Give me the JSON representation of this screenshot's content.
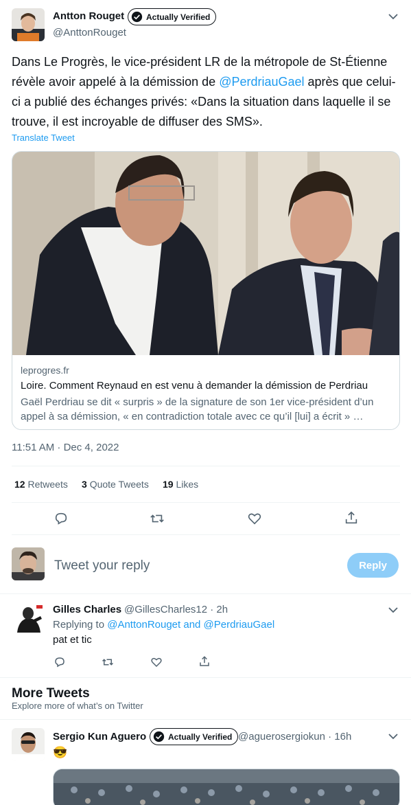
{
  "main_tweet": {
    "author_name": "Antton Rouget",
    "verified_badge": "Actually Verified",
    "author_handle": "@AnttonRouget",
    "text_before": "Dans Le Progrès, le vice-président LR de la métropole de St-Étienne révèle avoir appelé à la démission de ",
    "mention": "@PerdriauGael",
    "text_after": " après que celui-ci a publié des échanges privés: «Dans la situation dans laquelle il se trouve, il est incroyable de diffuser des SMS».",
    "translate_label": "Translate Tweet",
    "timestamp": "11:51 AM · Dec 4, 2022"
  },
  "link_card": {
    "domain": "leprogres.fr",
    "title": "Loire. Comment Reynaud en est venu à demander la démission de Perdriau",
    "description": "Gaël Perdriau se dit « surpris » de la signature de son 1er  vice-président d’un appel à sa démission, « en contradiction totale avec ce qu’il [lui] a écrit » …"
  },
  "stats": {
    "retweets_count": "12",
    "retweets_label": "Retweets",
    "quotes_count": "3",
    "quotes_label": "Quote Tweets",
    "likes_count": "19",
    "likes_label": "Likes"
  },
  "reply_box": {
    "placeholder": "Tweet your reply",
    "button_label": "Reply"
  },
  "reply_tweet": {
    "author_name": "Gilles Charles",
    "author_handle": "@GillesCharles12 · 2h",
    "replying_prefix": "Replying to ",
    "replying_to": "@AnttonRouget and @PerdriauGael",
    "text": "pat et tic"
  },
  "more_tweets": {
    "title": "More Tweets",
    "subtitle": "Explore more of what’s on Twitter"
  },
  "next_tweet": {
    "author_name": "Sergio Kun Aguero",
    "verified_badge": "Actually Verified",
    "author_handle": "@aguerosergiokun · 16h",
    "text": "😎"
  },
  "colors": {
    "accent": "#1d9bf0",
    "secondary_text": "#536471",
    "border": "#cfd9de",
    "reply_button_disabled": "#8ecdf8"
  },
  "icons": {
    "more": "chevron-down-icon",
    "badge": "verified-check-icon",
    "reply": "reply-icon",
    "retweet": "retweet-icon",
    "like": "heart-icon",
    "share": "share-icon"
  }
}
